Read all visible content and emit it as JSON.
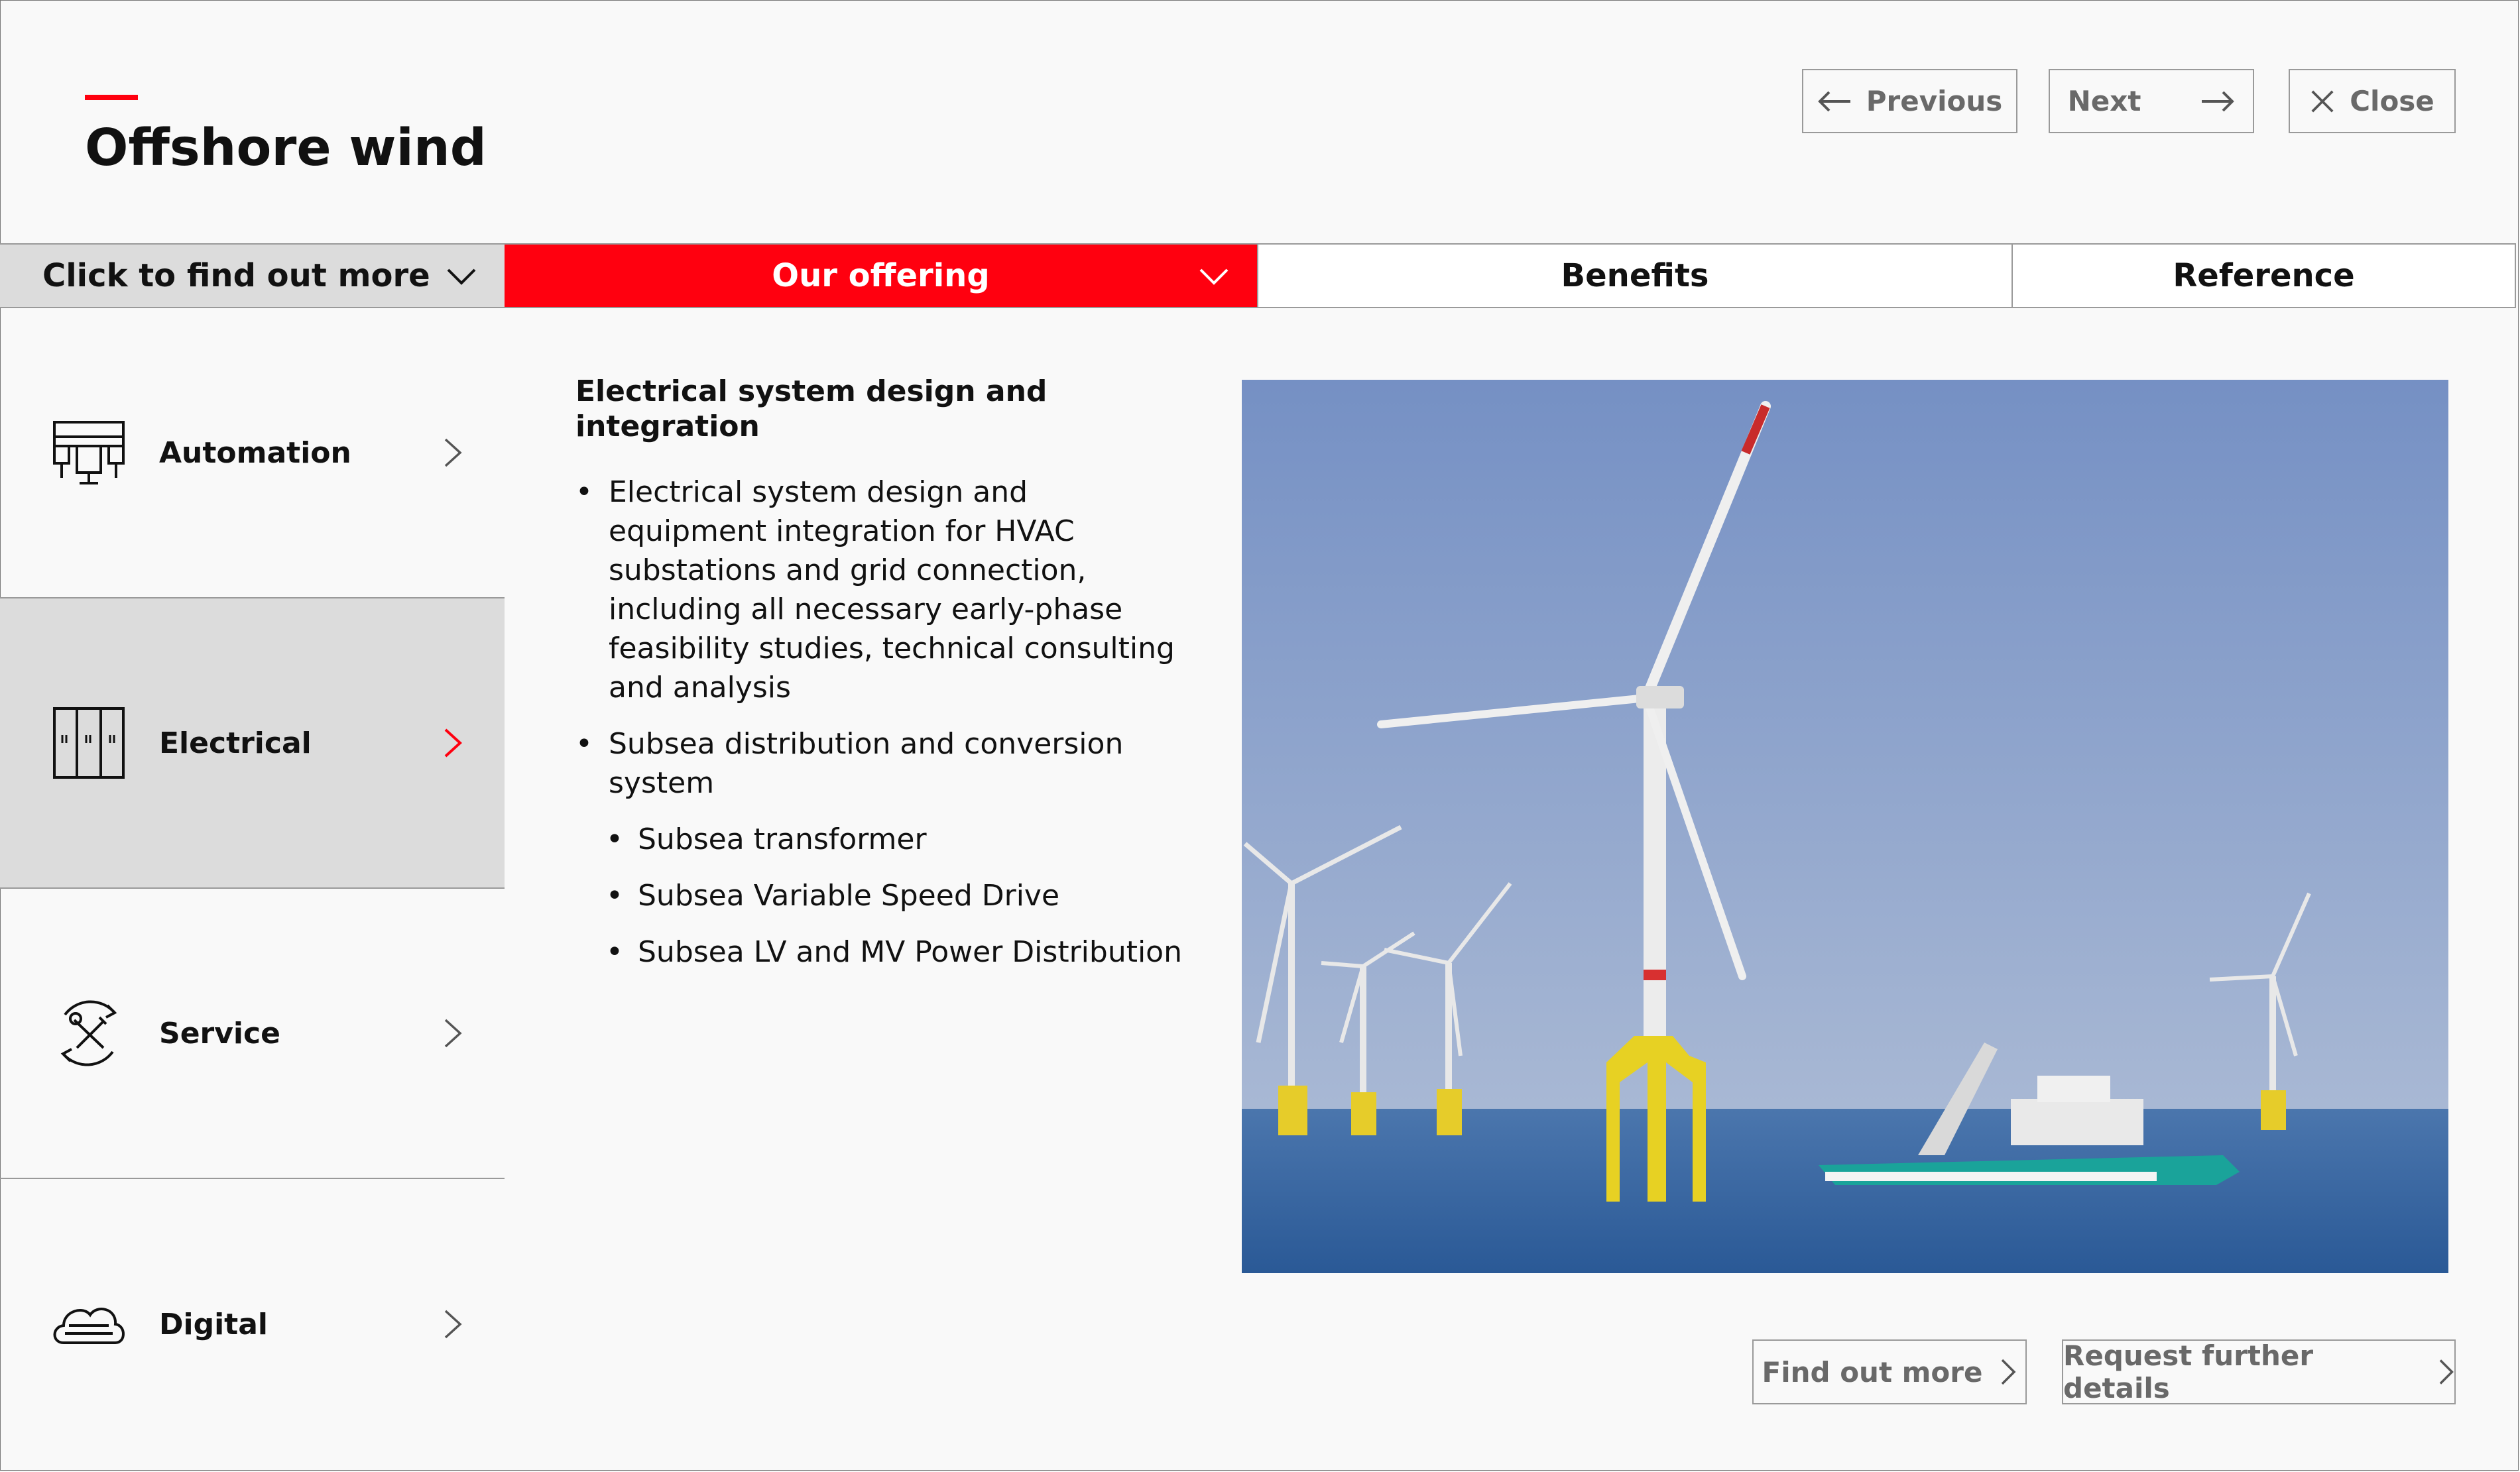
{
  "page": {
    "title": "Offshore wind",
    "accent_color": "#ff000f"
  },
  "header_nav": {
    "previous_label": "Previous",
    "next_label": "Next",
    "close_label": "Close"
  },
  "tabs": {
    "dropdown_label": "Click to find out more",
    "items": [
      {
        "label": "Our offering",
        "active": true
      },
      {
        "label": "Benefits",
        "active": false
      },
      {
        "label": "Reference",
        "active": false
      }
    ]
  },
  "sidebar": {
    "items": [
      {
        "label": "Automation",
        "icon": "automation-icon",
        "active": false
      },
      {
        "label": "Electrical",
        "icon": "electrical-cabinet-icon",
        "active": true
      },
      {
        "label": "Service",
        "icon": "service-tools-icon",
        "active": false
      },
      {
        "label": "Digital",
        "icon": "cloud-icon",
        "active": false
      }
    ]
  },
  "content": {
    "heading": "Electrical system design and integration",
    "bullets": [
      "Electrical system design and equipment integration for HVAC substations and grid connection, including all necessary early-phase feasibility studies, technical consulting and analysis",
      "Subsea distribution and conversion system"
    ],
    "sub_bullets": [
      "Subsea transformer",
      "Subsea Variable Speed Drive",
      "Subsea LV and MV Power Distribution"
    ]
  },
  "actions": {
    "find_out_more_label": "Find out more",
    "request_details_label": "Request further details"
  }
}
